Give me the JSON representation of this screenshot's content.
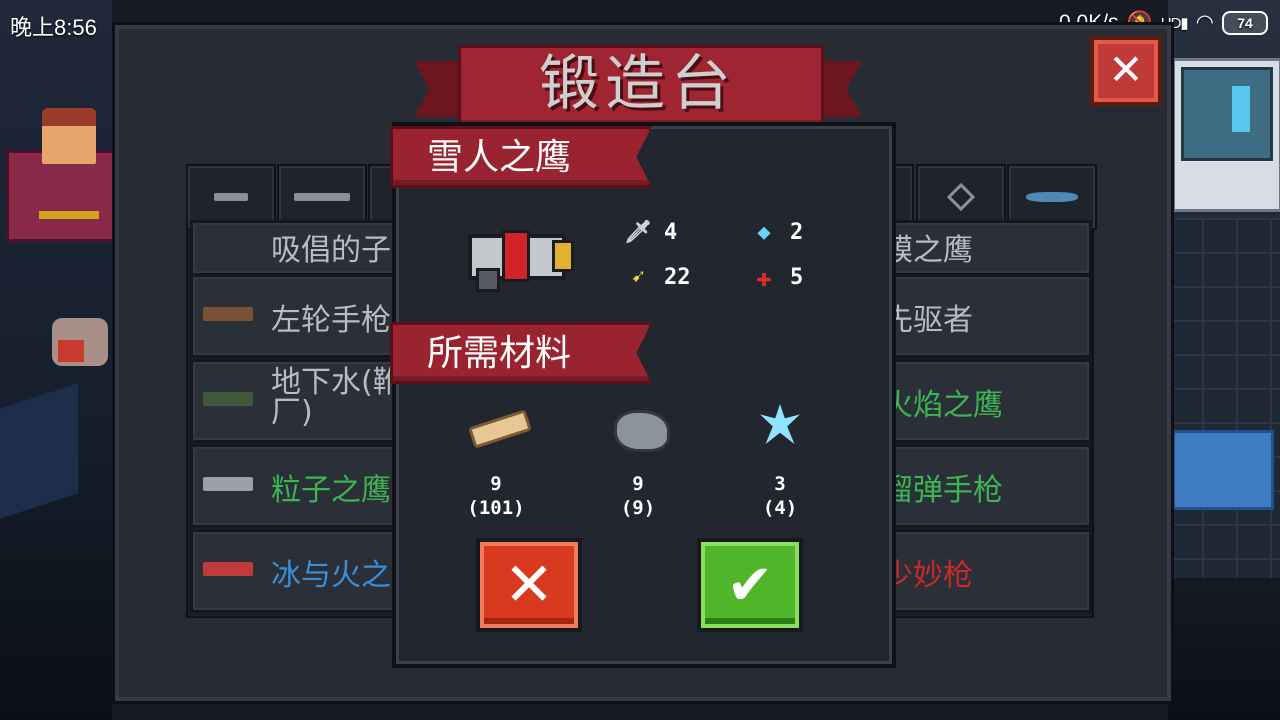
{
  "status_bar": {
    "time": "晚上8:56",
    "network_speed": "0.0K/s",
    "signal": "HD",
    "battery": "74"
  },
  "forge": {
    "title": "锻造台",
    "close_icon": "close-icon",
    "tabs": [
      {
        "icon": "pistol-icon"
      },
      {
        "icon": "rifle-icon"
      },
      {
        "icon": "rifle-icon"
      },
      {
        "icon": "laser-icon"
      },
      {
        "icon": "diamond-icon"
      },
      {
        "icon": "fish-icon"
      }
    ],
    "weapons_left": [
      {
        "name": "吸倡的子",
        "color": "#b8bcc2"
      },
      {
        "name": "左轮手枪",
        "color": "#b8bcc2"
      },
      {
        "name": "地下水(靴\n厂)",
        "color": "#b8bcc2"
      },
      {
        "name": "粒子之鹰",
        "color": "#3db552"
      },
      {
        "name": "冰与火之",
        "color": "#3a8fd6"
      }
    ],
    "weapons_right": [
      {
        "name": "馍之鹰",
        "color": "#b8bcc2"
      },
      {
        "name": "先驱者",
        "color": "#b8bcc2"
      },
      {
        "name": "火焰之鹰",
        "color": "#3db552"
      },
      {
        "name": "溜弹手枪",
        "color": "#3db552"
      },
      {
        "name": "少妙枪",
        "color": "#c9282c"
      }
    ]
  },
  "dialog": {
    "weapon_name": "雪人之鹰",
    "stats": {
      "damage": "4",
      "energy": "2",
      "ammo": "22",
      "crit": "5"
    },
    "materials_title": "所需材料",
    "materials": [
      {
        "icon": "wood-plank-icon",
        "required": "9",
        "owned": "(101)"
      },
      {
        "icon": "iron-ore-icon",
        "required": "9",
        "owned": "(9)"
      },
      {
        "icon": "ice-crystal-icon",
        "required": "3",
        "owned": "(4)"
      }
    ],
    "cancel_icon": "x-icon",
    "confirm_icon": "checkmark-icon"
  }
}
